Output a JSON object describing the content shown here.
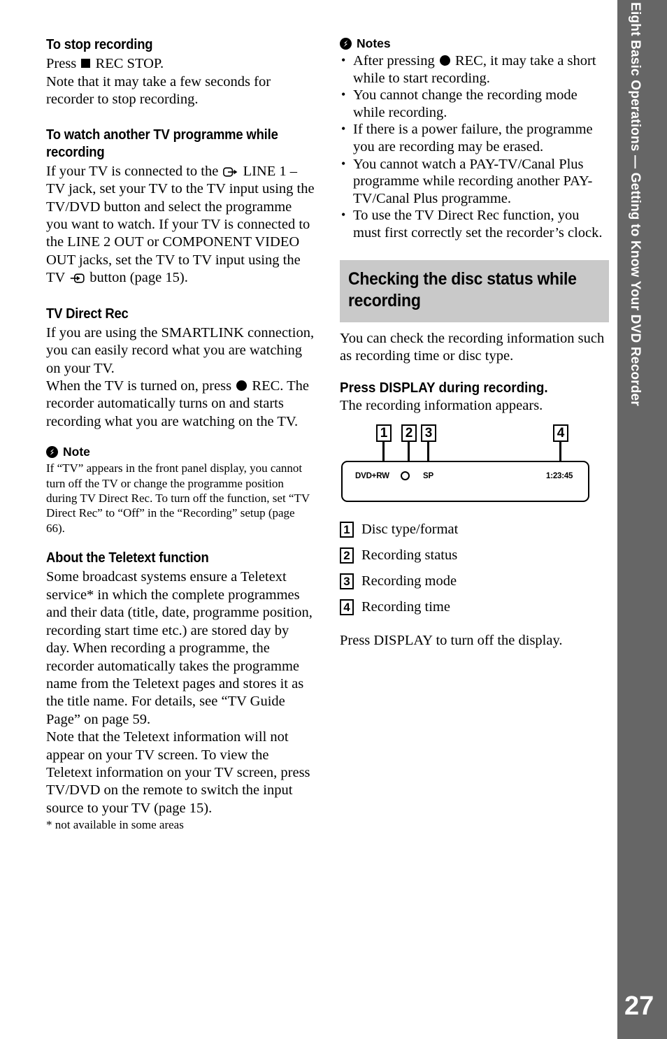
{
  "page": {
    "number": "27",
    "side_tab_label": "Eight Basic Operations — Getting to Know Your DVD Recorder",
    "colors": {
      "side_tab": "#666666",
      "banner": "#c9c9c9",
      "text": "#000000"
    }
  },
  "left_column": {
    "section_stop_recording": {
      "heading": "To stop recording",
      "line_press_prefix": "Press",
      "line_press_suffix": "REC STOP.",
      "paragraph": "Note that it may take a few seconds for recorder to stop recording."
    },
    "section_watch_another": {
      "heading": "To watch another TV programme while recording",
      "part1": "If your TV is connected to the",
      "part2": "LINE 1 – TV jack, set your TV to the TV input using the TV/DVD button and select the programme you want to watch. If your TV is connected to the LINE 2 OUT or COMPONENT VIDEO OUT jacks, set the TV to TV input using the TV",
      "part3": "button (page 15)."
    },
    "section_tv_direct_rec": {
      "heading": "TV Direct Rec",
      "paragraph1": "If you are using the SMARTLINK connection, you can easily record what you are watching on your TV.",
      "paragraph2_part1": "When the TV is turned on, press",
      "paragraph2_part2": "REC. The recorder automatically turns on and starts recording what you are watching on the TV."
    },
    "note": {
      "heading": "Note",
      "icon": "note-bolt-icon",
      "body": "If “TV” appears in the front panel display, you cannot turn off the TV or change the programme position during TV Direct Rec. To turn off the function, set “TV Direct Rec” to “Off” in the “Recording” setup (page 66)."
    },
    "section_teletext": {
      "heading": "About the Teletext function",
      "paragraph": "Some broadcast systems ensure a Teletext service* in which the complete programmes and their data (title, date, programme position, recording start time etc.) are stored day by day. When recording a programme, the recorder automatically takes the programme name from the Teletext pages and stores it as the title name. For details, see “TV Guide Page” on page 59.",
      "paragraph2": "Note that the Teletext information will not appear on your TV screen. To view the Teletext information on your TV screen, press TV/DVD on the remote to switch the input source to your TV (page 15).",
      "footnote": "* not available in some areas"
    }
  },
  "right_column": {
    "notes": {
      "heading": "Notes",
      "icon": "note-bolt-icon",
      "items": [
        {
          "prefix": "After pressing",
          "symbol": "rec-circle-icon",
          "suffix": "REC, it may take a short while to start recording."
        },
        {
          "prefix": "",
          "symbol": "",
          "suffix": "You cannot change the recording mode while recording."
        },
        {
          "prefix": "",
          "symbol": "",
          "suffix": "If there is a power failure, the programme you are recording may be erased."
        },
        {
          "prefix": "",
          "symbol": "",
          "suffix": "You cannot watch a PAY-TV/Canal Plus programme while recording another PAY-TV/Canal Plus programme."
        },
        {
          "prefix": "",
          "symbol": "",
          "suffix": "To use the TV Direct Rec function, you must first correctly set the recorder’s clock."
        }
      ]
    },
    "banner_title": "Checking the disc status while recording",
    "intro": "You can check the recording information such as recording time or disc type.",
    "sub_heading": "Press DISPLAY during recording.",
    "sub_paragraph": "The recording information appears.",
    "display_figure": {
      "callouts": [
        "1",
        "2",
        "3",
        "4"
      ],
      "panel": {
        "disc_type": "DVD+RW",
        "recording_status_icon": "record-circle-outline-icon",
        "recording_mode": "SP",
        "recording_time": "1:23:45"
      }
    },
    "legend": [
      {
        "num": "1",
        "label": "Disc type/format"
      },
      {
        "num": "2",
        "label": "Recording status"
      },
      {
        "num": "3",
        "label": "Recording mode"
      },
      {
        "num": "4",
        "label": "Recording time"
      }
    ],
    "closing": "Press DISPLAY to turn off the display."
  }
}
